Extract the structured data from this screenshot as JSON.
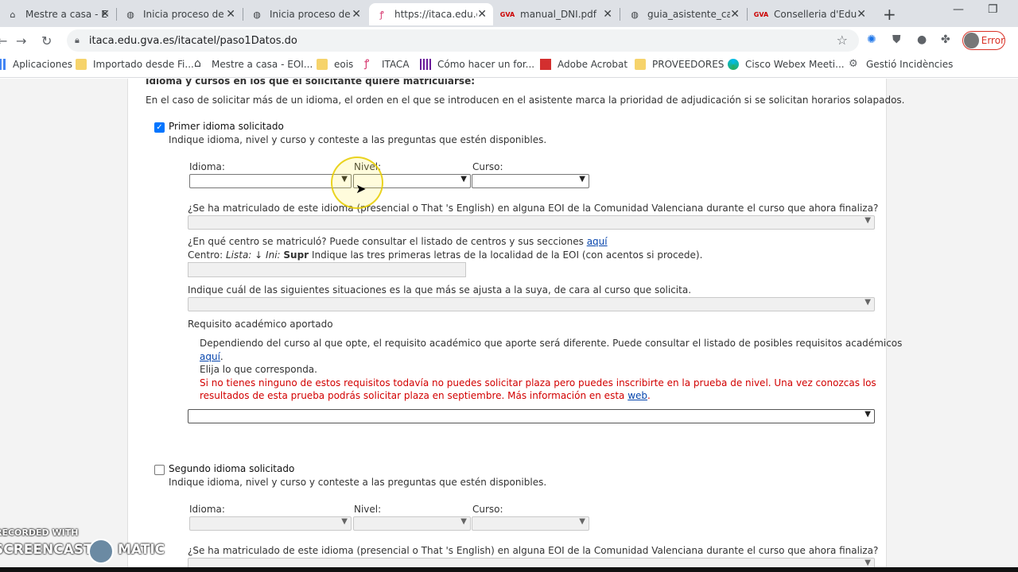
{
  "browser": {
    "tabs": [
      {
        "title": "Mestre a casa - EO",
        "favicon": "home-icon"
      },
      {
        "title": "Inicia proceso de a",
        "favicon": "globe-icon"
      },
      {
        "title": "Inicia proceso de a",
        "favicon": "globe-icon"
      },
      {
        "title": "https://itaca.edu.g",
        "favicon": "itaca-icon",
        "active": true
      },
      {
        "title": "manual_DNI.pdf",
        "favicon": "gva-icon"
      },
      {
        "title": "guia_asistente_cas",
        "favicon": "globe-icon"
      },
      {
        "title": "Conselleria d'Educ",
        "favicon": "gva-icon"
      }
    ],
    "url": "itaca.edu.gva.es/itacatel/paso1Datos.do",
    "error_label": "Error",
    "bookmarks": [
      {
        "label": "Aplicaciones",
        "icon": "apps-grid-icon"
      },
      {
        "label": "Importado desde Fi...",
        "icon": "folder-icon"
      },
      {
        "label": "Mestre a casa - EOI...",
        "icon": "home-icon"
      },
      {
        "label": "eois",
        "icon": "folder-icon"
      },
      {
        "label": "ITACA",
        "icon": "itaca-icon"
      },
      {
        "label": "Cómo hacer un for...",
        "icon": "bars-icon"
      },
      {
        "label": "Adobe Acrobat",
        "icon": "pdf-icon"
      },
      {
        "label": "PROVEEDORES",
        "icon": "folder-icon"
      },
      {
        "label": "Cisco Webex Meeti...",
        "icon": "webex-icon"
      },
      {
        "label": "Gestió Incidències",
        "icon": "gear-icon"
      }
    ]
  },
  "form": {
    "section_title": "Idioma y cursos en los que el solicitante quiere matricularse:",
    "intro": "En el caso de solicitar más de un idioma, el orden en el que se introducen en el asistente marca la prioridad de adjudicación si se solicitan horarios solapados.",
    "first": {
      "checked": true,
      "label": "Primer idioma solicitado",
      "hint": "Indique idioma, nivel y curso y conteste a las preguntas que estén disponibles.",
      "idioma_label": "Idioma:",
      "nivel_label": "Nivel:",
      "curso_label": "Curso:",
      "q_matriculado": "¿Se ha matriculado de este idioma (presencial o That 's English) en alguna EOI de la Comunidad Valenciana durante el curso que ahora finaliza?",
      "q_centro": "¿En qué centro se matriculó? Puede consultar el listado de centros y sus secciones",
      "q_centro_link": "aquí",
      "centro_label": "Centro:",
      "centro_lista": "Lista: ↓",
      "centro_ini": "Ini:",
      "centro_supr": "Supr",
      "centro_hint": "Indique las tres primeras letras de la localidad de la EOI (con acentos si procede).",
      "q_situacion": "Indique cuál de las siguientes situaciones es la que más se ajusta a la suya, de cara al curso que solicita.",
      "req_title": "Requisito académico aportado",
      "req_text1": "Dependiendo del curso al que opte, el requisito académico que aporte será diferente. Puede consultar el listado de posibles requisitos académicos",
      "req_link": "aquí",
      "req_text2": "Elija lo que corresponda.",
      "req_warn1": "Si no tienes ninguno de estos requisitos todavía no puedes solicitar plaza pero puedes inscribirte en la prueba de nivel. Una vez conozcas los",
      "req_warn2": "resultados de esta prueba podrás solicitar plaza en septiembre. Más información en esta",
      "req_warn_link": "web"
    },
    "second": {
      "checked": false,
      "label": "Segundo idioma solicitado",
      "hint": "Indique idioma, nivel y curso y conteste a las preguntas que estén disponibles.",
      "idioma_label": "Idioma:",
      "nivel_label": "Nivel:",
      "curso_label": "Curso:",
      "q_matriculado": "¿Se ha matriculado de este idioma (presencial o That 's English) en alguna EOI de la Comunidad Valenciana durante el curso que ahora finaliza?"
    }
  },
  "watermark": {
    "line1": "RECORDED WITH",
    "line2a": "SCREENCAST",
    "line2b": "MATIC"
  }
}
